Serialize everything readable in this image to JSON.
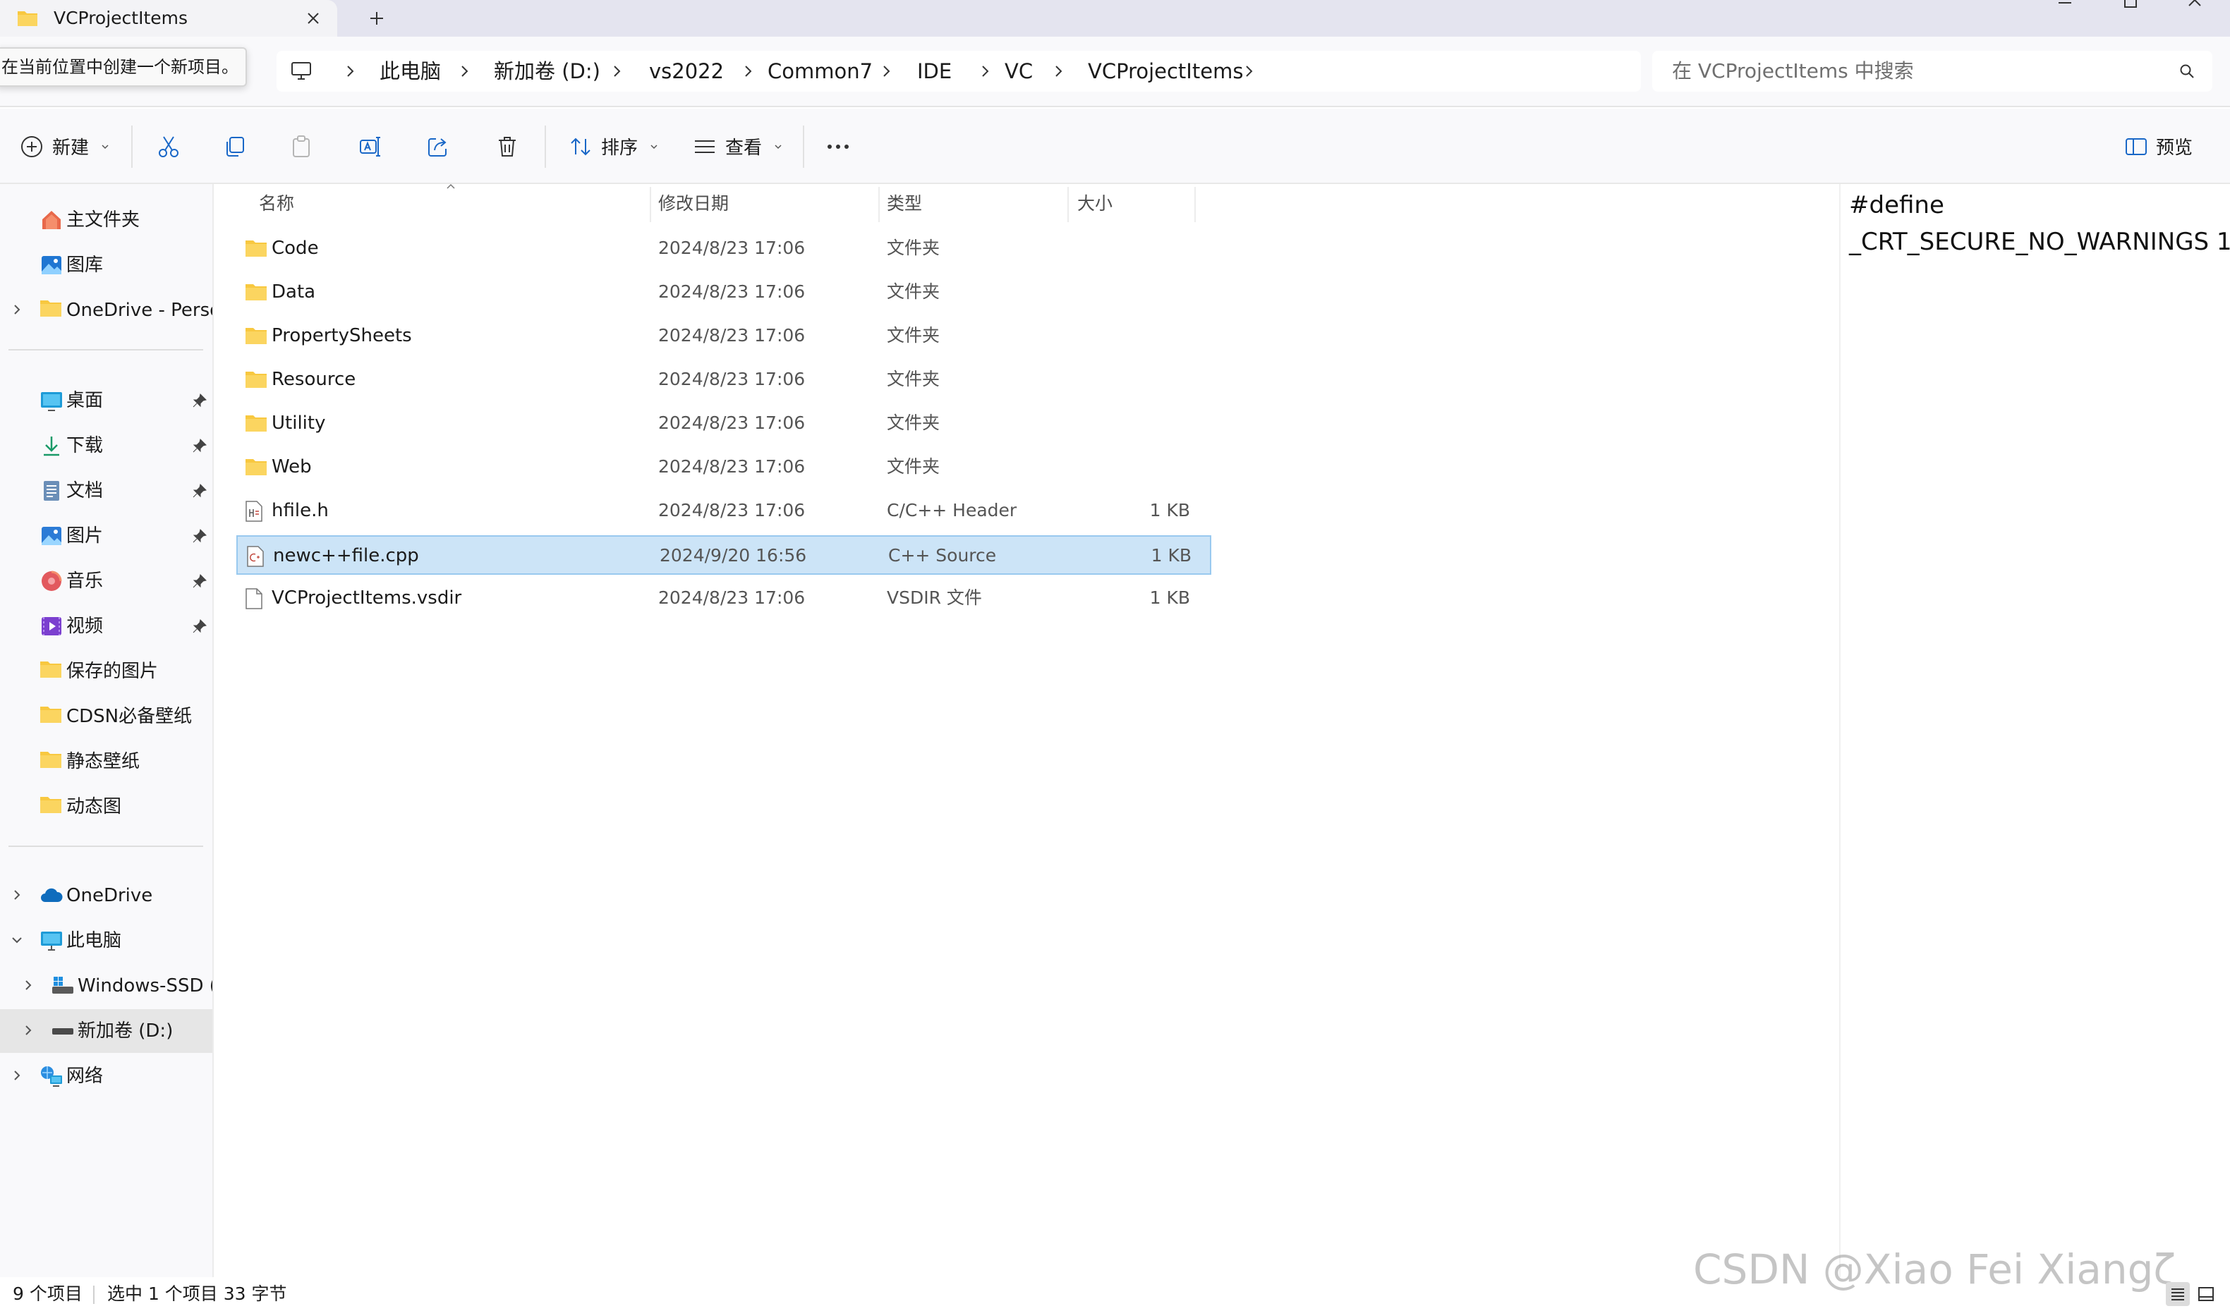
{
  "window": {
    "tab_title": "VCProjectItems"
  },
  "tooltip": "在当前位置中创建一个新项目。",
  "breadcrumb": [
    "此电脑",
    "新加卷 (D:)",
    "vs2022",
    "Common7",
    "IDE",
    "VC",
    "VCProjectItems"
  ],
  "search": {
    "placeholder": "在 VCProjectItems 中搜索"
  },
  "toolbar": {
    "new_label": "新建",
    "sort_label": "排序",
    "view_label": "查看",
    "preview_label": "预览"
  },
  "nav": {
    "items": [
      {
        "label": "主文件夹",
        "icon": "home-icon"
      },
      {
        "label": "图库",
        "icon": "gallery-icon"
      },
      {
        "label": "OneDrive - Persor",
        "icon": "folder-icon"
      },
      {
        "label": "桌面",
        "icon": "desktop-icon"
      },
      {
        "label": "下载",
        "icon": "download-icon"
      },
      {
        "label": "文档",
        "icon": "documents-icon"
      },
      {
        "label": "图片",
        "icon": "pictures-icon"
      },
      {
        "label": "音乐",
        "icon": "music-icon"
      },
      {
        "label": "视频",
        "icon": "videos-icon"
      },
      {
        "label": "保存的图片",
        "icon": "folder-icon"
      },
      {
        "label": "CDSN必备壁纸",
        "icon": "folder-icon"
      },
      {
        "label": "静态壁纸",
        "icon": "folder-icon"
      },
      {
        "label": "动态图",
        "icon": "folder-icon"
      },
      {
        "label": "OneDrive",
        "icon": "cloud-icon"
      },
      {
        "label": "此电脑",
        "icon": "computer-icon"
      },
      {
        "label": "Windows-SSD (C",
        "icon": "drive-icon"
      },
      {
        "label": "新加卷 (D:)",
        "icon": "drive-icon"
      },
      {
        "label": "网络",
        "icon": "network-icon"
      }
    ]
  },
  "columns": {
    "name": "名称",
    "date": "修改日期",
    "type": "类型",
    "size": "大小"
  },
  "files": [
    {
      "name": "Code",
      "date": "2024/8/23 17:06",
      "type": "文件夹",
      "size": "",
      "icon": "folder-icon"
    },
    {
      "name": "Data",
      "date": "2024/8/23 17:06",
      "type": "文件夹",
      "size": "",
      "icon": "folder-icon"
    },
    {
      "name": "PropertySheets",
      "date": "2024/8/23 17:06",
      "type": "文件夹",
      "size": "",
      "icon": "folder-icon"
    },
    {
      "name": "Resource",
      "date": "2024/8/23 17:06",
      "type": "文件夹",
      "size": "",
      "icon": "folder-icon"
    },
    {
      "name": "Utility",
      "date": "2024/8/23 17:06",
      "type": "文件夹",
      "size": "",
      "icon": "folder-icon"
    },
    {
      "name": "Web",
      "date": "2024/8/23 17:06",
      "type": "文件夹",
      "size": "",
      "icon": "folder-icon"
    },
    {
      "name": "hfile.h",
      "date": "2024/8/23 17:06",
      "type": "C/C++ Header",
      "size": "1 KB",
      "icon": "header-file-icon"
    },
    {
      "name": "newc++file.cpp",
      "date": "2024/9/20 16:56",
      "type": "C++ Source",
      "size": "1 KB",
      "icon": "source-file-icon",
      "selected": true
    },
    {
      "name": "VCProjectItems.vsdir",
      "date": "2024/8/23 17:06",
      "type": "VSDIR 文件",
      "size": "1 KB",
      "icon": "file-icon"
    }
  ],
  "preview": {
    "lines": [
      "#define",
      "_CRT_SECURE_NO_WARNINGS 1"
    ]
  },
  "status": {
    "count": "9 个项目",
    "selection": "选中 1 个项目  33 字节"
  },
  "watermark": "CSDN @Xiao Fei Xiangζ",
  "colors": {
    "selection": "#cce4f7",
    "folder": "#f8c840",
    "accent": "#0067c0"
  }
}
